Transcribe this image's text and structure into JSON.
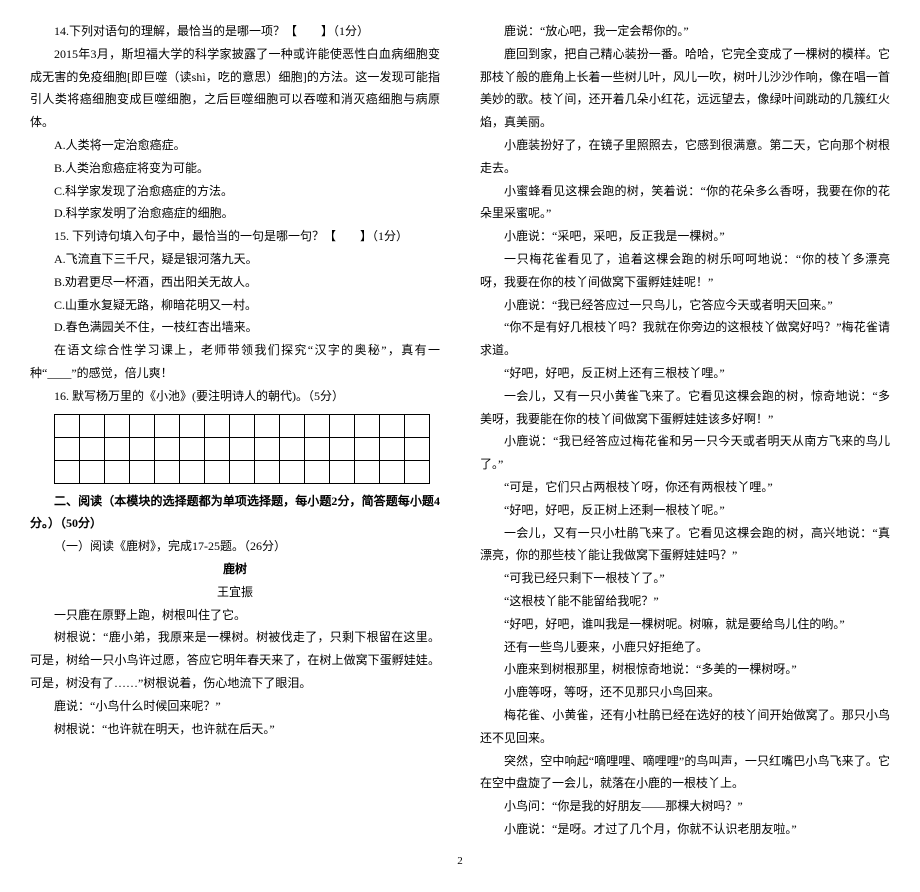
{
  "left": {
    "q14_title": "14.下列对语句的理解，最恰当的是哪一项？【　　】（1分）",
    "q14_passage": "2015年3月，斯坦福大学的科学家披露了一种或许能使恶性白血病细胞变成无害的免疫细胞[即巨噬（读shì，吃的意思）细胞]的方法。这一发现可能指引人类将癌细胞变成巨噬细胞，之后巨噬细胞可以吞噬和消灭癌细胞与病原体。",
    "q14_a": "A.人类将一定治愈癌症。",
    "q14_b": "B.人类治愈癌症将变为可能。",
    "q14_c": "C.科学家发现了治愈癌症的方法。",
    "q14_d": "D.科学家发明了治愈癌症的细胞。",
    "q15_title": "15. 下列诗句填入句子中，最恰当的一句是哪一句？【　　】（1分）",
    "q15_a": "A.飞流直下三千尺，疑是银河落九天。",
    "q15_b": "B.劝君更尽一杯酒，西出阳关无故人。",
    "q15_c": "C.山重水复疑无路，柳暗花明又一村。",
    "q15_d": "D.春色满园关不住，一枝红杏出墙来。",
    "q15_stem": "在语文综合性学习课上，老师带领我们探究“汉字的奥秘”，真有一种“____”的感觉，倍儿爽！",
    "q16": "16. 默写杨万里的《小池》(要注明诗人的朝代)。（5分）",
    "section2": "二、阅读（本模块的选择题都为单项选择题，每小题2分，简答题每小题4分。）（50分）",
    "reading1": "（一）阅读《鹿树》，完成17-25题。（26分）",
    "story_title": "鹿树",
    "story_author": "王宜振",
    "s1": "一只鹿在原野上跑，树根叫住了它。",
    "s2": "树根说：“鹿小弟，我原来是一棵树。树被伐走了，只剩下根留在这里。可是，树给一只小鸟许过愿，答应它明年春天来了，在树上做窝下蛋孵娃娃。可是，树没有了……”树根说着，伤心地流下了眼泪。",
    "s3": "鹿说：“小鸟什么时候回来呢？”",
    "s4": "树根说：“也许就在明天，也许就在后天。”"
  },
  "right": {
    "r1": "鹿说：“放心吧，我一定会帮你的。”",
    "r2": "鹿回到家，把自己精心装扮一番。哈哈，它完全变成了一棵树的模样。它那枝丫般的鹿角上长着一些树儿叶，风儿一吹，树叶儿沙沙作响，像在唱一首美妙的歌。枝丫间，还开着几朵小红花，远远望去，像绿叶间跳动的几簇红火焰，真美丽。",
    "r3": "小鹿装扮好了，在镜子里照照去，它感到很满意。第二天，它向那个树根走去。",
    "r4": "小蜜蜂看见这棵会跑的树，笑着说：“你的花朵多么香呀，我要在你的花朵里采蜜呢。”",
    "r5": "小鹿说：“采吧，采吧，反正我是一棵树。”",
    "r6": "一只梅花雀看见了，追着这棵会跑的树乐呵呵地说：“你的枝丫多漂亮呀，我要在你的枝丫间做窝下蛋孵娃娃呢！”",
    "r7": "小鹿说：“我已经答应过一只鸟儿，它答应今天或者明天回来。”",
    "r8": "“你不是有好几根枝丫吗？我就在你旁边的这根枝丫做窝好吗？”梅花雀请求道。",
    "r9": "“好吧，好吧，反正树上还有三根枝丫哩。”",
    "r10": "一会儿，又有一只小黄雀飞来了。它看见这棵会跑的树，惊奇地说：“多美呀，我要能在你的枝丫间做窝下蛋孵娃娃该多好啊！”",
    "r11": "小鹿说：“我已经答应过梅花雀和另一只今天或者明天从南方飞来的鸟儿了。”",
    "r12": "“可是，它们只占两根枝丫呀，你还有两根枝丫哩。”",
    "r13": "“好吧，好吧，反正树上还剩一根枝丫呢。”",
    "r14": "一会儿，又有一只小杜鹃飞来了。它看见这棵会跑的树，高兴地说：“真漂亮，你的那些枝丫能让我做窝下蛋孵娃娃吗？”",
    "r15": "“可我已经只剩下一根枝丫了。”",
    "r16": "“这根枝丫能不能留给我呢？”",
    "r17": "“好吧，好吧，谁叫我是一棵树呢。树嘛，就是要给鸟儿住的哟。”",
    "r18": "还有一些鸟儿要来，小鹿只好拒绝了。",
    "r19": "小鹿来到树根那里，树根惊奇地说：“多美的一棵树呀。”",
    "r20": "小鹿等呀，等呀，还不见那只小鸟回来。",
    "r21": "梅花雀、小黄雀，还有小杜鹃已经在选好的枝丫间开始做窝了。那只小鸟还不见回来。",
    "r22": "突然，空中响起“嘀哩哩、嘀哩哩”的鸟叫声，一只红嘴巴小鸟飞来了。它在空中盘旋了一会儿，就落在小鹿的一根枝丫上。",
    "r23": "小鸟问：“你是我的好朋友——那棵大树吗？”",
    "r24": "小鹿说：“是呀。才过了几个月，你就不认识老朋友啦。”"
  },
  "page_number": "2"
}
